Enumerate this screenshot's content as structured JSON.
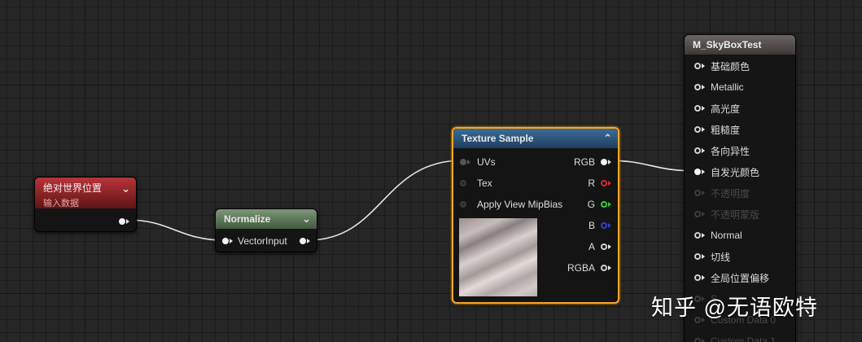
{
  "nodes": {
    "absolute_world_position": {
      "title": "绝对世界位置",
      "subtitle": "输入数据"
    },
    "normalize": {
      "title": "Normalize",
      "input_label": "VectorInput"
    },
    "texture_sample": {
      "title": "Texture Sample",
      "inputs": [
        "UVs",
        "Tex",
        "Apply View MipBias"
      ],
      "outputs": [
        "RGB",
        "R",
        "G",
        "B",
        "A",
        "RGBA"
      ],
      "output_colors": [
        "#f2f2f2",
        "#d42a2a",
        "#33cc33",
        "#2d3fcf",
        "#d0d0d0",
        "#f2f2f2"
      ]
    },
    "material": {
      "title": "M_SkyBoxTest",
      "inputs": [
        {
          "label": "基础颜色",
          "enabled": true,
          "connected": false
        },
        {
          "label": "Metallic",
          "enabled": true,
          "connected": false
        },
        {
          "label": "高光度",
          "enabled": true,
          "connected": false
        },
        {
          "label": "粗糙度",
          "enabled": true,
          "connected": false
        },
        {
          "label": "各向异性",
          "enabled": true,
          "connected": false
        },
        {
          "label": "自发光颜色",
          "enabled": true,
          "connected": true
        },
        {
          "label": "不透明度",
          "enabled": false,
          "connected": false
        },
        {
          "label": "不透明蒙版",
          "enabled": false,
          "connected": false
        },
        {
          "label": "Normal",
          "enabled": true,
          "connected": false
        },
        {
          "label": "切线",
          "enabled": true,
          "connected": false
        },
        {
          "label": "全局位置偏移",
          "enabled": true,
          "connected": false
        },
        {
          "label": "S",
          "enabled": false,
          "connected": false
        },
        {
          "label": "Custom Data 0",
          "enabled": false,
          "connected": false
        },
        {
          "label": "Custom Data 1",
          "enabled": false,
          "connected": false
        }
      ]
    }
  },
  "watermark": "知乎 @无语欧特",
  "colors": {
    "selection": "#f5a623",
    "wire": "#e8e8e8"
  }
}
